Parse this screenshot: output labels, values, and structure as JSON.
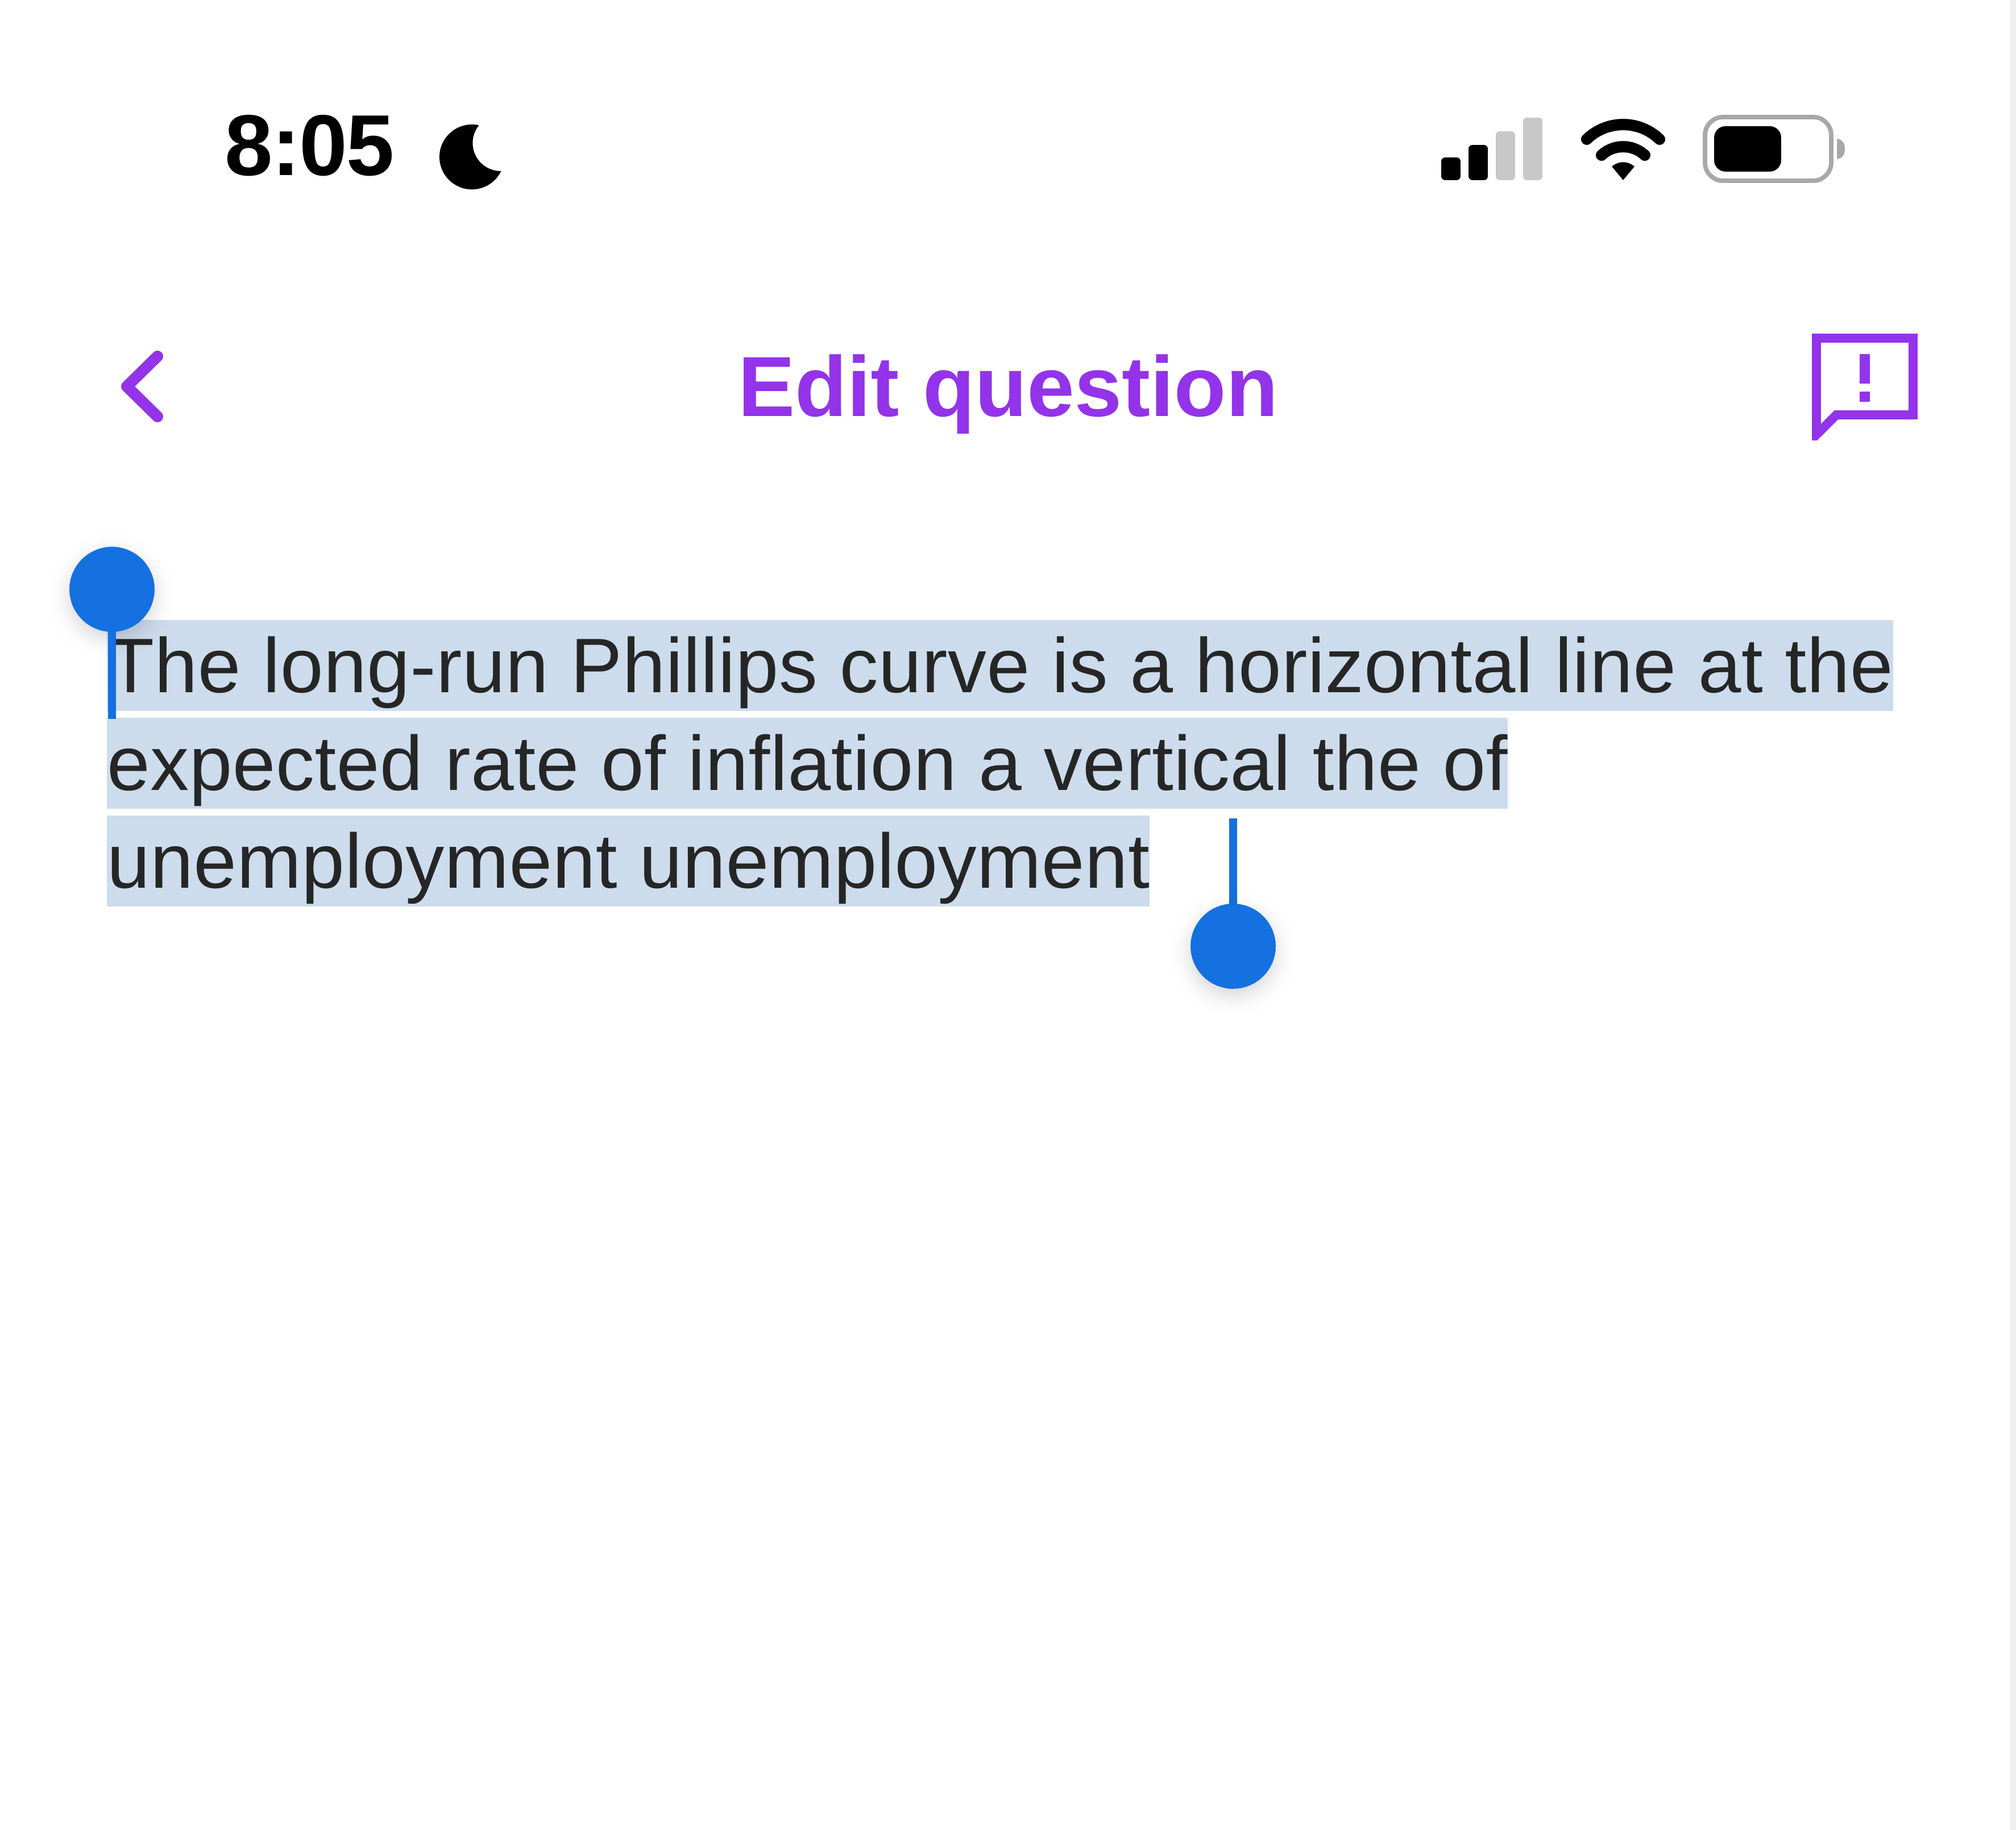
{
  "status_bar": {
    "time": "8:05",
    "focus_icon": "moon-icon",
    "signal_icon": "cellular-signal-icon",
    "wifi_icon": "wifi-icon",
    "battery_icon": "battery-icon"
  },
  "nav": {
    "back_icon": "chevron-left-icon",
    "title": "Edit question",
    "report_icon": "report-feedback-icon"
  },
  "question": {
    "text": "The long-run Phillips curve is a horizontal line at the expected rate of inflation a vertical the of unemployment unemployment",
    "selected": true
  },
  "colors": {
    "accent": "#9333ea",
    "selection_handle": "#1570e0",
    "selection_highlight": "#cddcec",
    "text": "#262626"
  }
}
